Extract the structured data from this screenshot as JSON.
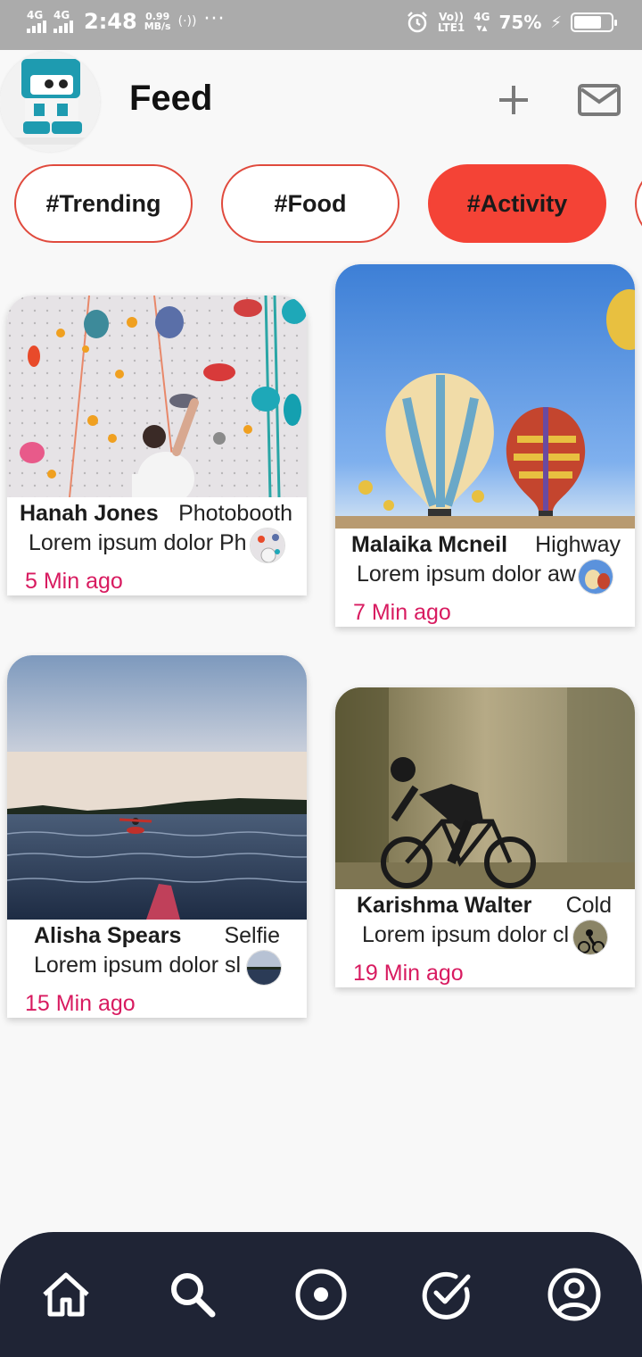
{
  "status_bar": {
    "network1": "4G",
    "network2": "4G",
    "time": "2:48",
    "speed_value": "0.99",
    "speed_unit": "MB/s",
    "volte_top": "Vo))",
    "volte_bottom": "LTE1",
    "net_right": "4G",
    "battery": "75%",
    "battery_level": 0.75
  },
  "header": {
    "title": "Feed"
  },
  "chips": [
    {
      "label": "#Trending",
      "active": false
    },
    {
      "label": "#Food",
      "active": false
    },
    {
      "label": "#Activity",
      "active": true
    }
  ],
  "cards": [
    {
      "name": "Hanah Jones",
      "tag": "Photobooth",
      "desc": "Lorem ipsum dolor Ph",
      "time": "5 Min ago"
    },
    {
      "name": "Malaika Mcneil",
      "tag": "Highway",
      "desc": "Lorem ipsum dolor aw",
      "time": "7 Min ago"
    },
    {
      "name": "Alisha Spears",
      "tag": "Selfie",
      "desc": "Lorem ipsum dolor sl",
      "time": "15 Min ago"
    },
    {
      "name": "Karishma Walter",
      "tag": "Cold",
      "desc": "Lorem ipsum dolor cl",
      "time": "19 Min ago"
    }
  ],
  "colors": {
    "accent": "#f44336",
    "chip_border": "#e04a3d",
    "time_text": "#d81b60",
    "nav_bg": "#1f2435"
  },
  "bottom_nav": [
    {
      "icon": "home-icon"
    },
    {
      "icon": "search-icon"
    },
    {
      "icon": "record-icon"
    },
    {
      "icon": "check-circle-icon"
    },
    {
      "icon": "profile-icon"
    }
  ]
}
